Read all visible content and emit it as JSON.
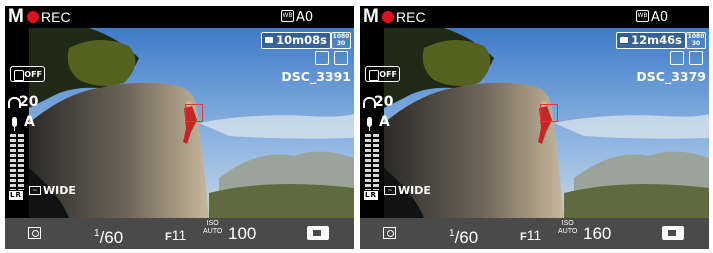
{
  "colors": {
    "rec": "#e0101c",
    "bottom_bar": "#4a4a4a",
    "focus_box": "#e23b2e"
  },
  "icons": {
    "touch_shutter": "touch-shutter-icon",
    "headphone": "headphone-icon",
    "microphone": "microphone-icon",
    "wind_filter": "wind-filter-icon",
    "metering": "matrix-metering-icon",
    "movie": "movie-camera-icon",
    "white_balance": "white-balance-icon"
  },
  "screens": [
    {
      "mode": "M",
      "rec_label": "REC",
      "wb_value": "A0",
      "remaining_time": "10m08s",
      "resolution": "1080 30",
      "file_name": "DSC_3391",
      "touch_label": "OFF",
      "headphone_volume": "20",
      "mic_sensitivity": "A",
      "meter_labels": "LR",
      "wind_label": "WIDE",
      "shutter_numerator": "1",
      "shutter_denominator": "60",
      "aperture_prefix": "F",
      "aperture_value": "11",
      "iso_label_top": "ISO",
      "iso_label_bottom": "AUTO",
      "iso_value": "100"
    },
    {
      "mode": "M",
      "rec_label": "REC",
      "wb_value": "A0",
      "remaining_time": "12m46s",
      "resolution": "1080 30",
      "file_name": "DSC_3379",
      "touch_label": "OFF",
      "headphone_volume": "20",
      "mic_sensitivity": "A",
      "meter_labels": "LR",
      "wind_label": "WIDE",
      "shutter_numerator": "1",
      "shutter_denominator": "60",
      "aperture_prefix": "F",
      "aperture_value": "11",
      "iso_label_top": "ISO",
      "iso_label_bottom": "AUTO",
      "iso_value": "160"
    }
  ]
}
